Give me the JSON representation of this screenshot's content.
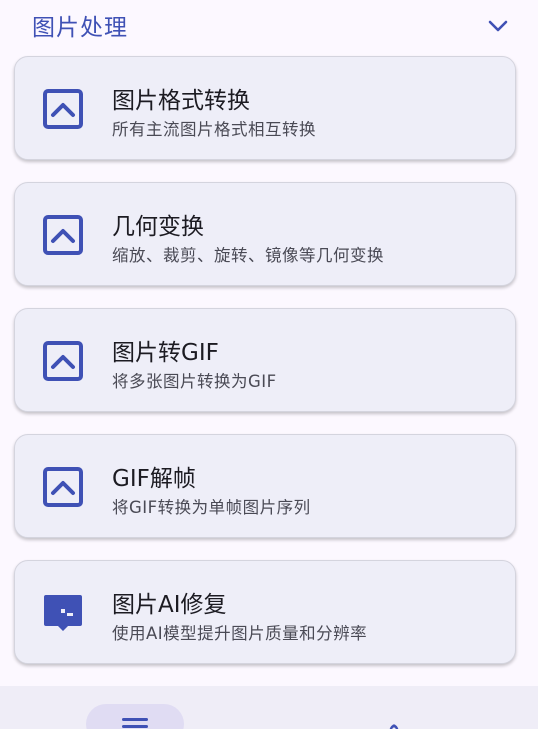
{
  "section": {
    "title": "图片处理",
    "toggle_icon": "chevron-down-icon"
  },
  "cards": [
    {
      "title": "图片格式转换",
      "desc": "所有主流图片格式相互转换",
      "icon": "image-icon"
    },
    {
      "title": "几何变换",
      "desc": "缩放、裁剪、旋转、镜像等几何变换",
      "icon": "image-icon"
    },
    {
      "title": "图片转GIF",
      "desc": "将多张图片转换为GIF",
      "icon": "image-icon"
    },
    {
      "title": "GIF解帧",
      "desc": "将GIF转换为单帧图片序列",
      "icon": "image-icon"
    },
    {
      "title": "图片AI修复",
      "desc": "使用AI模型提升图片质量和分辨率",
      "icon": "chat-bubble-icon"
    }
  ],
  "bottom_nav": {
    "items": [
      {
        "icon": "menu-icon",
        "active": true
      },
      {
        "icon": "settings-icon",
        "active": false
      }
    ]
  },
  "colors": {
    "accent": "#3f51b5",
    "card_bg": "#eeeef8",
    "page_bg": "#fcf8ff"
  }
}
